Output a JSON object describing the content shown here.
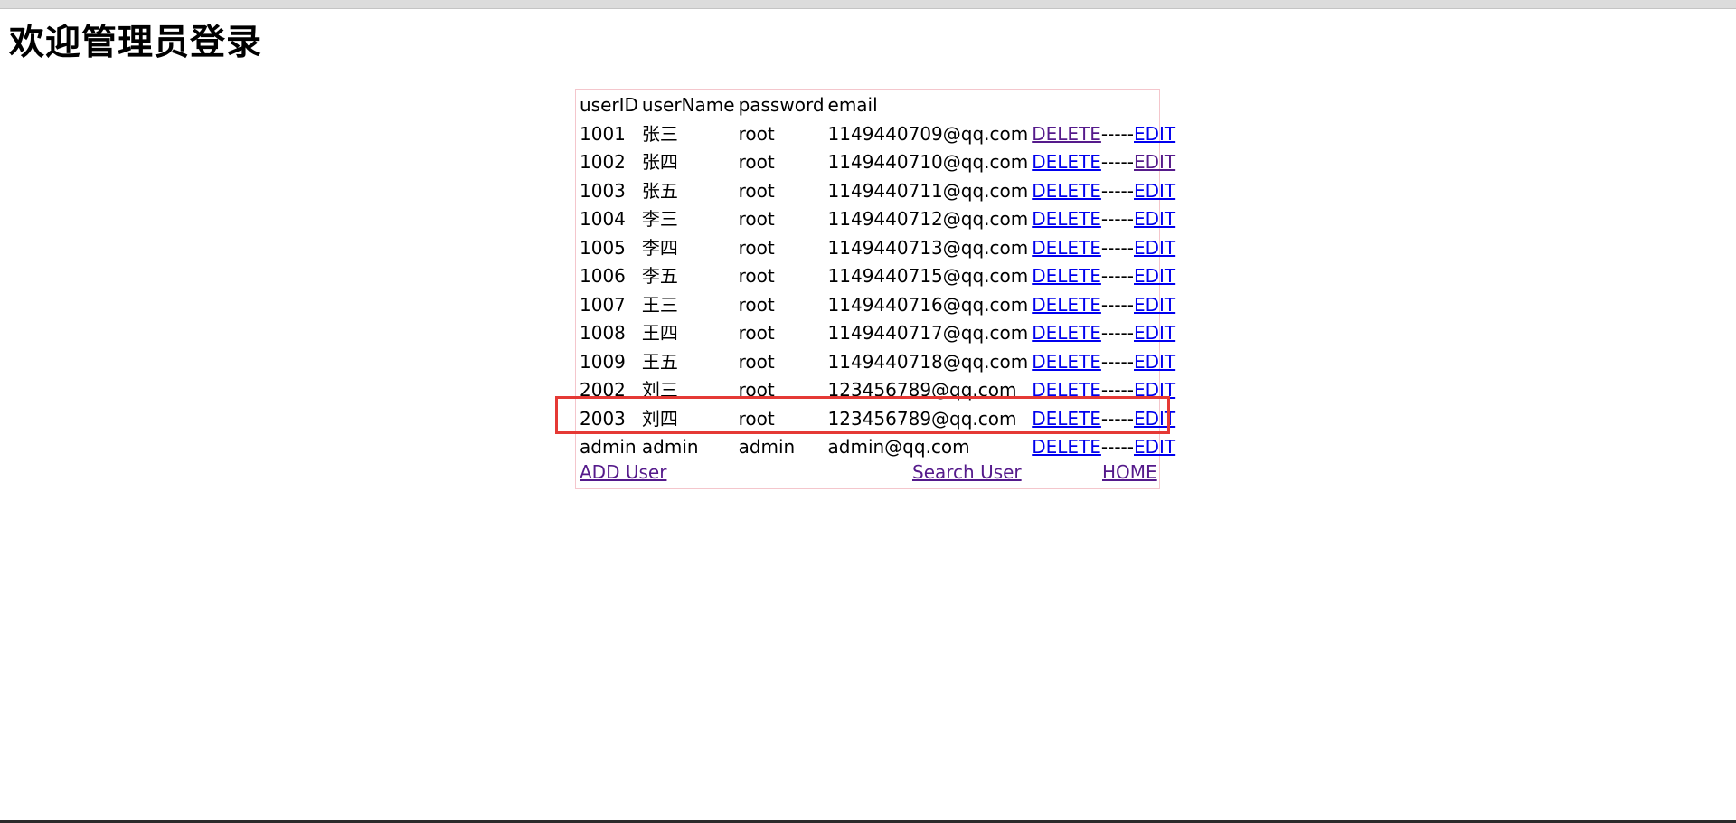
{
  "page": {
    "title": "欢迎管理员登录"
  },
  "table": {
    "headers": [
      "userID",
      "userName",
      "password",
      "email"
    ],
    "rows": [
      {
        "id": "1001",
        "name": "张三",
        "password": "root",
        "email": "1149440709@qq.com"
      },
      {
        "id": "1002",
        "name": "张四",
        "password": "root",
        "email": "1149440710@qq.com"
      },
      {
        "id": "1003",
        "name": "张五",
        "password": "root",
        "email": "1149440711@qq.com"
      },
      {
        "id": "1004",
        "name": "李三",
        "password": "root",
        "email": "1149440712@qq.com"
      },
      {
        "id": "1005",
        "name": "李四",
        "password": "root",
        "email": "1149440713@qq.com"
      },
      {
        "id": "1006",
        "name": "李五",
        "password": "root",
        "email": "1149440715@qq.com"
      },
      {
        "id": "1007",
        "name": "王三",
        "password": "root",
        "email": "1149440716@qq.com"
      },
      {
        "id": "1008",
        "name": "王四",
        "password": "root",
        "email": "1149440717@qq.com"
      },
      {
        "id": "1009",
        "name": "王五",
        "password": "root",
        "email": "1149440718@qq.com"
      },
      {
        "id": "2002",
        "name": "刘三",
        "password": "root",
        "email": "123456789@qq.com"
      },
      {
        "id": "2003",
        "name": "刘四",
        "password": "root",
        "email": "123456789@qq.com"
      },
      {
        "id": "admin",
        "name": "admin",
        "password": "admin",
        "email": "admin@qq.com"
      }
    ],
    "delete_label": "DELETE",
    "separator": "-----",
    "edit_label": "EDIT"
  },
  "footer": {
    "add_user": "ADD User",
    "search_user": "Search User",
    "home": "HOME"
  },
  "colors": {
    "link": "#0000ee",
    "visited_link": "#551a8b",
    "table_border": "#f4c6cc",
    "highlight": "#e53935"
  }
}
